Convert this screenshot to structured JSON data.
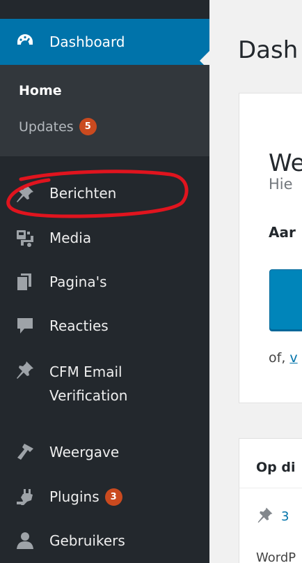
{
  "sidebar": {
    "dashboard": {
      "label": "Dashboard",
      "icon": "dashboard-icon"
    },
    "submenu": {
      "home": "Home",
      "updates": "Updates",
      "updates_count": "5"
    },
    "items": [
      {
        "label": "Berichten",
        "icon": "pushpin-icon"
      },
      {
        "label": "Media",
        "icon": "media-icon"
      },
      {
        "label": "Pagina's",
        "icon": "pages-icon"
      },
      {
        "label": "Reacties",
        "icon": "comments-icon"
      },
      {
        "label_line1": "CFM Email",
        "label_line2": "Verification",
        "icon": "pushpin-icon"
      },
      {
        "label": "Weergave",
        "icon": "appearance-icon"
      },
      {
        "label": "Plugins",
        "icon": "plugins-icon",
        "badge": "3"
      },
      {
        "label": "Gebruikers",
        "icon": "users-icon"
      }
    ]
  },
  "main": {
    "title": "Dash",
    "welcome": {
      "title": "We",
      "subtitle": "Hie",
      "get_started": "Aar",
      "or_prefix": "of, ",
      "or_link": "v"
    },
    "glance": {
      "title": "Op di",
      "count": "3",
      "footer": "WordP"
    }
  },
  "colors": {
    "sidebar_bg": "#23282d",
    "submenu_bg": "#32373c",
    "active_bg": "#0073aa",
    "badge_bg": "#ca4a1f",
    "button_bg": "#0085ba",
    "annotation_red": "#e0141e"
  }
}
